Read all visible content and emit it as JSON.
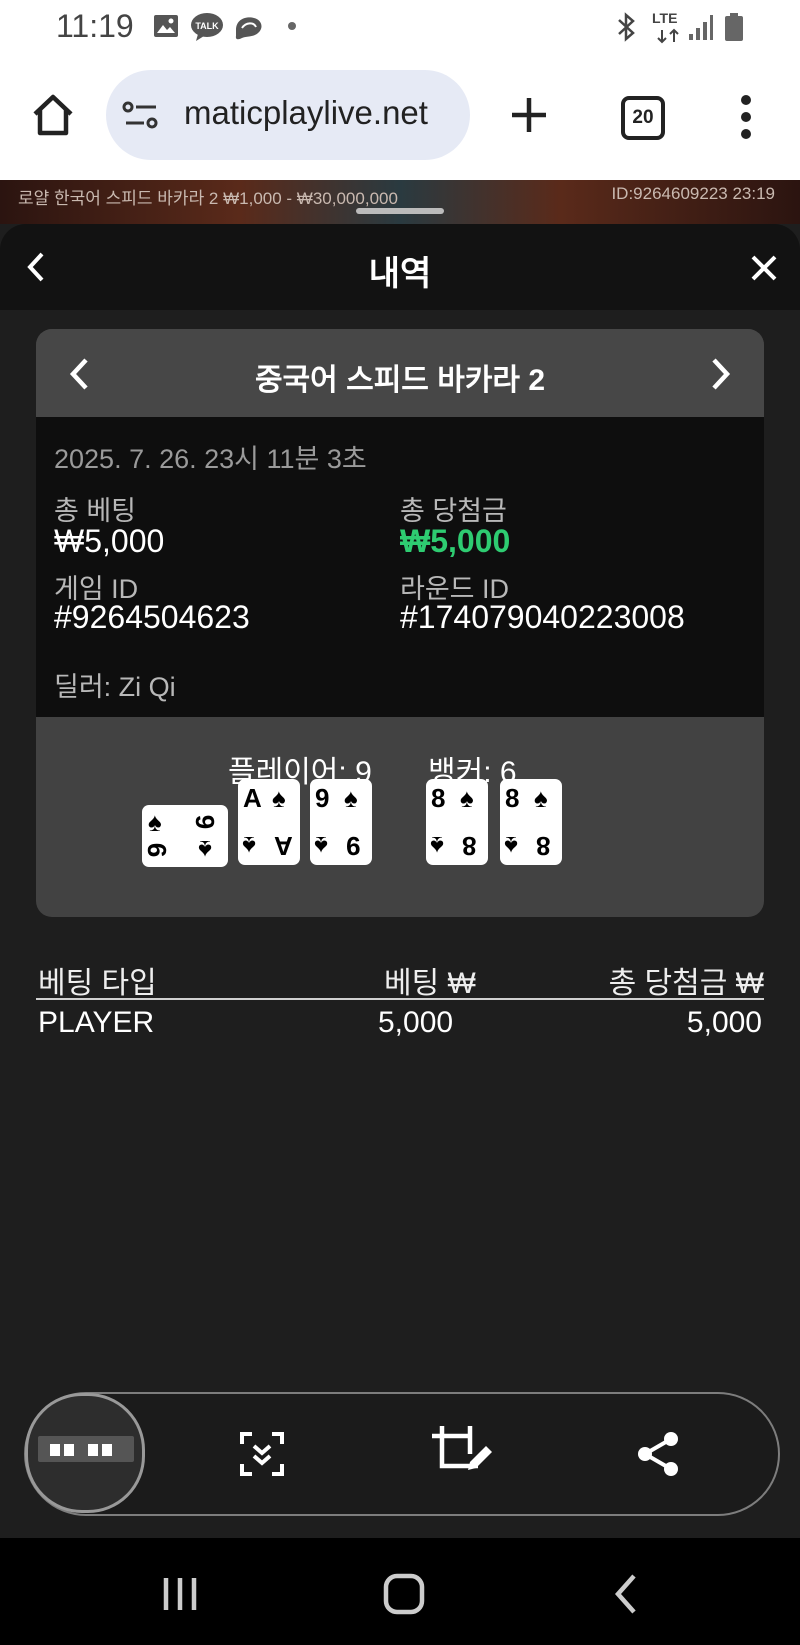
{
  "status_bar": {
    "time": "11:19",
    "icons": [
      "gallery-icon",
      "kakaotalk-icon",
      "thread-icon",
      "dot-icon"
    ],
    "network": "LTE",
    "right_icons": [
      "bluetooth-icon",
      "lte-icon",
      "signal-icon",
      "battery-icon"
    ]
  },
  "browser": {
    "url": "maticplaylive.net",
    "tab_count": "20"
  },
  "game_strip": {
    "left": "로얄 한국어 스피드 바카라 2  ₩1,000 - ₩30,000,000",
    "right": "ID:9264609223  23:19"
  },
  "sheet": {
    "title": "내역"
  },
  "history": {
    "game_name": "중국어 스피드 바카라 2",
    "datetime": "2025. 7. 26. 23시 11분 3초",
    "total_bet_label": "총 베팅",
    "total_bet_value": "₩5,000",
    "total_win_label": "총 당첨금",
    "total_win_value": "₩5,000",
    "game_id_label": "게임 ID",
    "game_id_value": "#9264504623",
    "round_id_label": "라운드 ID",
    "round_id_value": "#174079040223008",
    "dealer": "딜러: Zi Qi",
    "player_label": "플레이어: 9",
    "banker_label": "뱅커: 6",
    "player_cards": [
      {
        "rank": "9",
        "suit": "♠",
        "rotated": true
      },
      {
        "rank": "A",
        "suit": "♠"
      },
      {
        "rank": "9",
        "suit": "♠"
      }
    ],
    "banker_cards": [
      {
        "rank": "8",
        "suit": "♠"
      },
      {
        "rank": "8",
        "suit": "♠"
      }
    ]
  },
  "bets_table": {
    "headers": [
      "베팅 타입",
      "베팅 ₩",
      "총 당첨금 ₩"
    ],
    "rows": [
      {
        "type": "PLAYER",
        "bet": "5,000",
        "win": "5,000"
      }
    ]
  },
  "colors": {
    "win_green": "#2ecc71",
    "sheet_bg": "#1e1e1e"
  }
}
